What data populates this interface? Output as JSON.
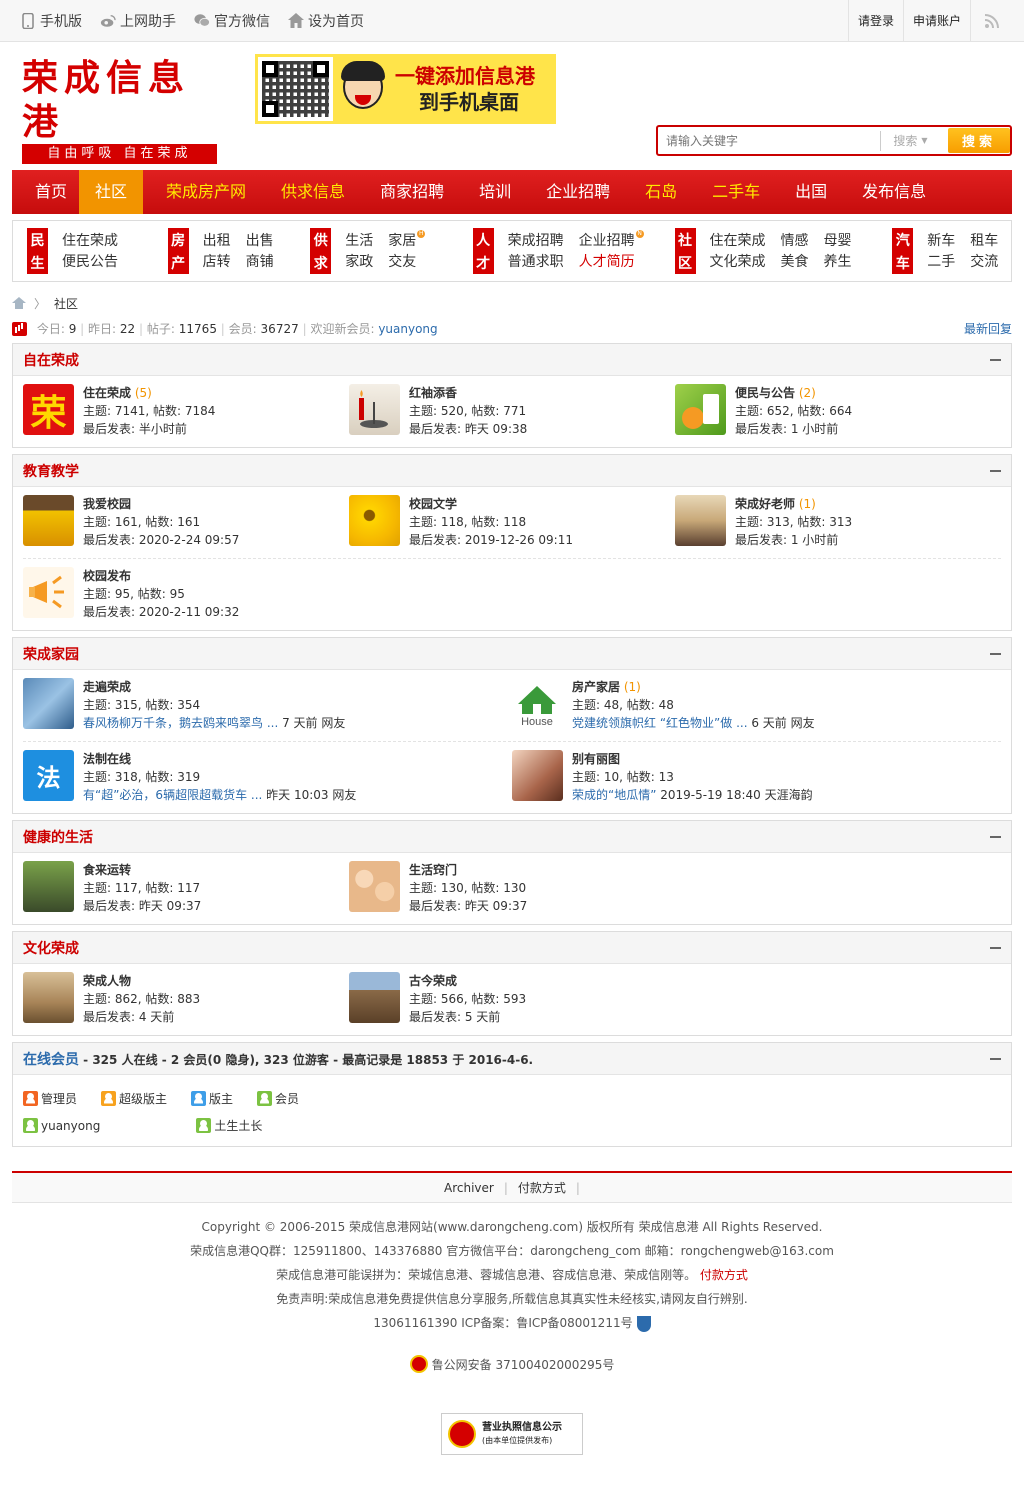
{
  "topbar": {
    "left": [
      {
        "label": "手机版",
        "icon": "phone-icon"
      },
      {
        "label": "上网助手",
        "icon": "weibo-icon"
      },
      {
        "label": "官方微信",
        "icon": "wechat-icon"
      },
      {
        "label": "设为首页",
        "icon": "home-icon"
      }
    ],
    "login": "请登录",
    "register": "申请账户"
  },
  "logo": {
    "main": "荣成信息港",
    "sub": "自由呼吸 自在荣成"
  },
  "banner": {
    "line1": "一键添加信息港",
    "line2": "到手机桌面"
  },
  "search": {
    "placeholder": "请输入关键字",
    "type": "搜索",
    "button": "搜索"
  },
  "nav": [
    {
      "label": "首页",
      "style": "normal"
    },
    {
      "label": "社区",
      "style": "active"
    },
    {
      "label": "荣成房产网",
      "style": "yellow"
    },
    {
      "label": "供求信息",
      "style": "yellow"
    },
    {
      "label": "商家招聘",
      "style": "normal"
    },
    {
      "label": "培训",
      "style": "normal"
    },
    {
      "label": "企业招聘",
      "style": "normal"
    },
    {
      "label": "石岛",
      "style": "yellow"
    },
    {
      "label": "二手车",
      "style": "yellow"
    },
    {
      "label": "出国",
      "style": "normal"
    },
    {
      "label": "发布信息",
      "style": "normal"
    }
  ],
  "categories": [
    {
      "tag": [
        "民",
        "生"
      ],
      "links": [
        {
          "t": "住在荣成"
        },
        {
          "t": "便民公告"
        }
      ],
      "width": 128
    },
    {
      "tag": [
        "房",
        "产"
      ],
      "links": [
        {
          "t": "出租"
        },
        {
          "t": "店转"
        },
        {
          "t": "出售"
        },
        {
          "t": "商铺"
        }
      ],
      "width": 130
    },
    {
      "tag": [
        "供",
        "求"
      ],
      "links": [
        {
          "t": "生活"
        },
        {
          "t": "家政"
        },
        {
          "t": "家居",
          "badge": "H"
        },
        {
          "t": "交友"
        }
      ],
      "width": 150
    },
    {
      "tag": [
        "人",
        "才"
      ],
      "links": [
        {
          "t": "荣成招聘"
        },
        {
          "t": "普通求职"
        },
        {
          "t": "企业招聘",
          "badge": "N"
        },
        {
          "t": "人才简历",
          "red": true
        }
      ],
      "width": 190
    },
    {
      "tag": [
        "社",
        "区"
      ],
      "links": [
        {
          "t": "住在荣成"
        },
        {
          "t": "文化荣成"
        },
        {
          "t": "情感"
        },
        {
          "t": "美食"
        },
        {
          "t": "母婴"
        },
        {
          "t": "养生"
        }
      ],
      "width": 206
    },
    {
      "tag": [
        "汽",
        "车"
      ],
      "links": [
        {
          "t": "新车"
        },
        {
          "t": "二手"
        },
        {
          "t": "租车"
        },
        {
          "t": "交流"
        }
      ],
      "width": 120
    }
  ],
  "breadcrumb": {
    "sep": "〉",
    "current": "社区"
  },
  "stats": {
    "today_label": "今日:",
    "today": "9",
    "yesterday_label": "昨日:",
    "yesterday": "22",
    "posts_label": "帖子:",
    "posts": "11765",
    "members_label": "会员:",
    "members": "36727",
    "welcome_label": "欢迎新会员:",
    "newest": "yuanyong",
    "latest_replies": "最新回复"
  },
  "sections": [
    {
      "title": "自在荣成",
      "cols": 3,
      "rows": [
        [
          {
            "name": "住在荣成",
            "new": "(5)",
            "meta": "主题: 7141, 帖数: 7184",
            "last": "最后发表: 半小时前",
            "icon": "rong-icon"
          },
          {
            "name": "红袖添香",
            "meta": "主题: 520, 帖数: 771",
            "last": "最后发表: 昨天 09:38",
            "icon": "candle-icon"
          },
          {
            "name": "便民与公告",
            "new": "(2)",
            "meta": "主题: 652, 帖数: 664",
            "last": "最后发表: 1 小时前",
            "icon": "notice-icon"
          }
        ]
      ]
    },
    {
      "title": "教育教学",
      "cols": 3,
      "rows": [
        [
          {
            "name": "我爱校园",
            "meta": "主题: 161, 帖数: 161",
            "last": "最后发表: 2020-2-24 09:57",
            "icon": "students-icon"
          },
          {
            "name": "校园文学",
            "meta": "主题: 118, 帖数: 118",
            "last": "最后发表: 2019-12-26 09:11",
            "icon": "sunflower-icon"
          },
          {
            "name": "荣成好老师",
            "new": "(1)",
            "meta": "主题: 313, 帖数: 313",
            "last": "最后发表: 1 小时前",
            "icon": "teacher-icon"
          }
        ],
        [
          {
            "name": "校园发布",
            "meta": "主题: 95, 帖数: 95",
            "last": "最后发表: 2020-2-11 09:32",
            "icon": "megaphone-icon"
          }
        ]
      ]
    },
    {
      "title": "荣成家园",
      "cols": 2,
      "rows": [
        [
          {
            "name": "走遍荣成",
            "meta": "主题: 315, 帖数: 354",
            "link": "春风杨柳万千条，鹅去鸥来鸣翠鸟 ...",
            "tail": "7 天前 网友",
            "icon": "swan-icon"
          },
          {
            "name": "房产家居",
            "new": "(1)",
            "meta": "主题: 48, 帖数: 48",
            "link": "党建统领旗帜红 “红色物业”做 ...",
            "tail": "6 天前 网友",
            "icon": "house-icon"
          }
        ],
        [
          {
            "name": "法制在线",
            "meta": "主题: 318, 帖数: 319",
            "link": "有“超”必治，6辆超限超载货车 ...",
            "tail": "昨天 10:03 网友",
            "icon": "law-icon"
          },
          {
            "name": "别有丽图",
            "meta": "主题: 10, 帖数: 13",
            "link": "荣成的“地瓜情”",
            "tail": "2019-5-19 18:40 天涯海韵",
            "icon": "portrait-icon"
          }
        ]
      ]
    },
    {
      "title": "健康的生活",
      "cols": 3,
      "rows": [
        [
          {
            "name": "食来运转",
            "meta": "主题: 117, 帖数: 117",
            "last": "最后发表: 昨天 09:37",
            "icon": "seacucumber-icon"
          },
          {
            "name": "生活窍门",
            "meta": "主题: 130, 帖数: 130",
            "last": "最后发表: 昨天 09:37",
            "icon": "eggs-icon"
          }
        ]
      ]
    },
    {
      "title": "文化荣成",
      "cols": 3,
      "rows": [
        [
          {
            "name": "荣成人物",
            "meta": "主题: 862, 帖数: 883",
            "last": "最后发表: 4 天前",
            "icon": "elder-icon"
          },
          {
            "name": "古今荣成",
            "meta": "主题: 566, 帖数: 593",
            "last": "最后发表: 5 天前",
            "icon": "cottage-icon"
          }
        ]
      ]
    }
  ],
  "online": {
    "title": "在线会员",
    "summary": " - 325 人在线 - 2 会员(0 隐身), 323 位游客 - 最高记录是 18853 于 2016-4-6.",
    "legend": [
      {
        "label": "管理员",
        "cls": "admin"
      },
      {
        "label": "超级版主",
        "cls": "super"
      },
      {
        "label": "版主",
        "cls": "mod"
      },
      {
        "label": "会员",
        "cls": "mem"
      }
    ],
    "users": [
      "yuanyong",
      "土生土长"
    ]
  },
  "footer": {
    "links": [
      "Archiver",
      "付款方式"
    ],
    "copyright": "Copyright © 2006-2015 荣成信息港网站(www.darongcheng.com) 版权所有 荣成信息港 All Rights Reserved.",
    "contact": "荣成信息港QQ群：125911800、143376880 官方微信平台：darongcheng_com 邮箱：rongchengweb@163.com",
    "aliases": "荣成信息港可能误拼为：荣城信息港、蓉城信息港、容成信息港、荣成信刚等。",
    "pay": "付款方式",
    "disclaimer": "免责声明:荣成信息港免费提供信息分享服务,所载信息其真实性未经核实,请网友自行辨别.",
    "icp": "13061161390 ICP备案：鲁ICP备08001211号",
    "police": "鲁公网安备 37100402000295号",
    "license_title": "营业执照信息公示",
    "license_sub": "(由本单位提供发布)"
  }
}
